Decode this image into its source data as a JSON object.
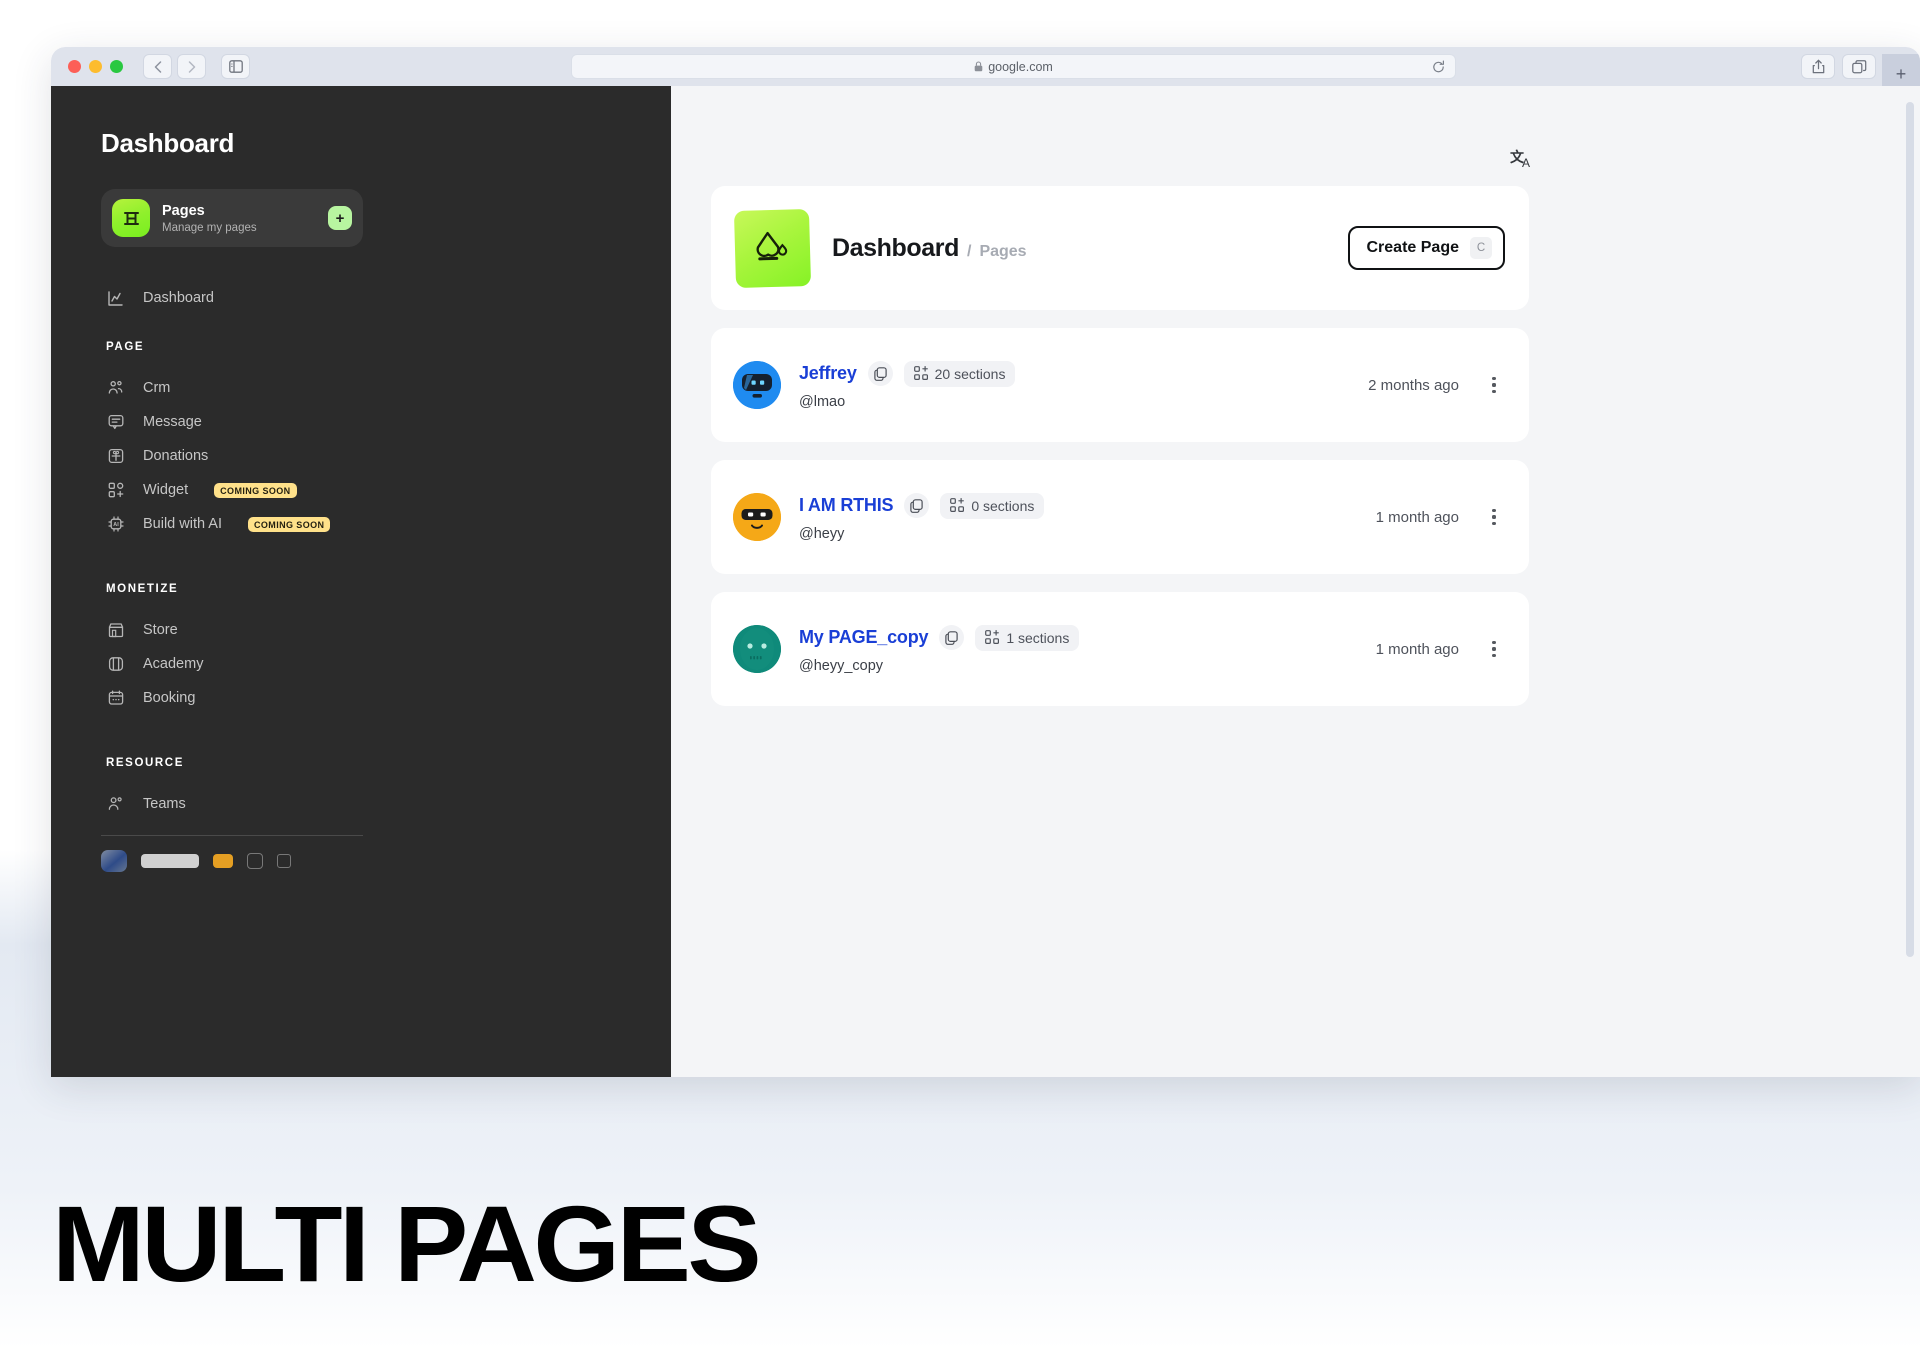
{
  "browser": {
    "url": "google.com",
    "lock_icon": "lock-icon",
    "reload_icon": "reload-icon",
    "back_icon": "chevron-left-icon",
    "forward_icon": "chevron-right-icon",
    "sidebar_toggle_icon": "sidebar-toggle-icon",
    "share_icon": "share-icon",
    "tabs_icon": "tab-overview-icon",
    "newtab_label": "+"
  },
  "sidebar": {
    "title": "Dashboard",
    "pages_card": {
      "name": "Pages",
      "subtitle": "Manage my pages",
      "icon": "pages-icon",
      "add_label": "+"
    },
    "top_items": [
      {
        "label": "Dashboard",
        "icon": "chart-line-icon"
      }
    ],
    "groups": [
      {
        "title": "PAGE",
        "items": [
          {
            "label": "Crm",
            "icon": "users-icon",
            "badge": ""
          },
          {
            "label": "Message",
            "icon": "message-icon",
            "badge": ""
          },
          {
            "label": "Donations",
            "icon": "gift-icon",
            "badge": ""
          },
          {
            "label": "Widget",
            "icon": "widget-add-icon",
            "badge": "COMING SOON"
          },
          {
            "label": "Build with AI",
            "icon": "ai-chip-icon",
            "badge": "COMING SOON"
          }
        ]
      },
      {
        "title": "MONETIZE",
        "items": [
          {
            "label": "Store",
            "icon": "store-icon",
            "badge": ""
          },
          {
            "label": "Academy",
            "icon": "book-icon",
            "badge": ""
          },
          {
            "label": "Booking",
            "icon": "calendar-icon",
            "badge": ""
          }
        ]
      },
      {
        "title": "RESOURCE",
        "items": [
          {
            "label": "Teams",
            "icon": "team-icon",
            "badge": ""
          }
        ]
      }
    ]
  },
  "main": {
    "translate_icon": "translate-icon",
    "header": {
      "logo_icon": "brand-drop-icon",
      "crumb_main": "Dashboard",
      "crumb_separator": "/",
      "crumb_sub": "Pages",
      "create_label": "Create Page",
      "create_shortcut": "C"
    },
    "rows": [
      {
        "name": "Jeffrey",
        "handle": "@lmao",
        "sections": "20 sections",
        "time": "2 months ago",
        "avatar_color": "#1f8bf0",
        "avatar_kind": "robot-blue",
        "copy_icon": "duplicate-icon",
        "sections_icon": "grid-plus-icon",
        "menu_icon": "kebab-menu-icon"
      },
      {
        "name": "I AM RTHIS",
        "handle": "@heyy",
        "sections": "0 sections",
        "time": "1 month ago",
        "avatar_color": "#f5a817",
        "avatar_kind": "robot-orange",
        "copy_icon": "duplicate-icon",
        "sections_icon": "grid-plus-icon",
        "menu_icon": "kebab-menu-icon"
      },
      {
        "name": "My PAGE_copy",
        "handle": "@heyy_copy",
        "sections": "1 sections",
        "time": "1 month ago",
        "avatar_color": "#0f8a7a",
        "avatar_kind": "robot-teal",
        "copy_icon": "duplicate-icon",
        "sections_icon": "grid-plus-icon",
        "menu_icon": "kebab-menu-icon"
      }
    ]
  },
  "caption": {
    "text": "MULTI PAGES"
  },
  "colors": {
    "accent_green": "#8ff02c",
    "link_blue": "#1a3fd6",
    "badge_yellow": "#ffe18a",
    "sidebar_bg": "#2b2b2b"
  }
}
